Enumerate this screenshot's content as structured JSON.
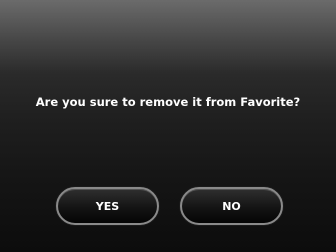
{
  "dialog": {
    "message": "Are you sure to remove it from Favorite?",
    "yes_label": "YES",
    "no_label": "NO"
  }
}
